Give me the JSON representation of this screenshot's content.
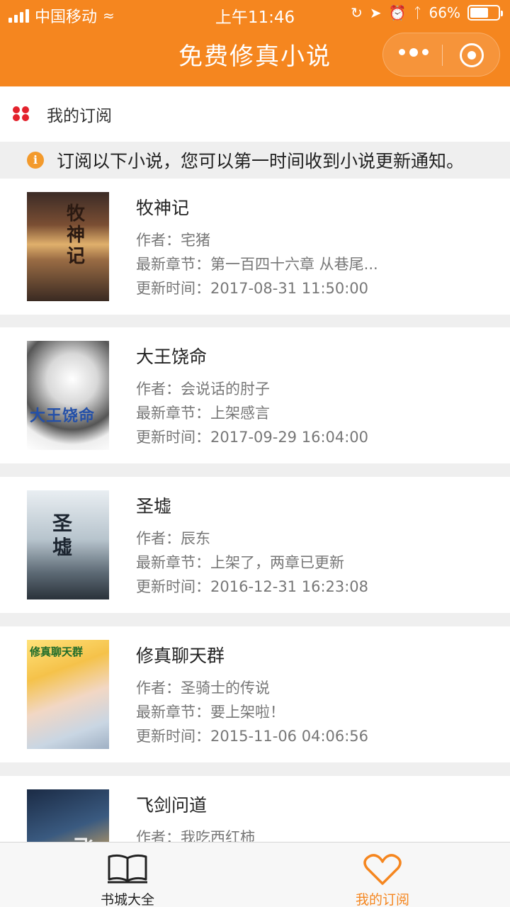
{
  "status_bar": {
    "carrier": "中国移动",
    "time": "上午11:46",
    "battery_text": "66%",
    "battery_level": 0.66
  },
  "nav": {
    "title": "免费修真小说"
  },
  "section": {
    "title": "我的订阅"
  },
  "notice": {
    "text": "订阅以下小说，您可以第一时间收到小说更新通知。"
  },
  "books": [
    {
      "title": "牧神记",
      "author": "作者：宅猪",
      "latest": "最新章节：第一百四十六章 从巷尾...",
      "updated": "更新时间：2017-08-31 11:50:00",
      "cover_text": "牧神记"
    },
    {
      "title": "大王饶命",
      "author": "作者：会说话的肘子",
      "latest": "最新章节：上架感言",
      "updated": "更新时间：2017-09-29 16:04:00",
      "cover_text": "大王饶命"
    },
    {
      "title": "圣墟",
      "author": "作者：辰东",
      "latest": "最新章节：上架了，两章已更新",
      "updated": "更新时间：2016-12-31 16:23:08",
      "cover_text": "圣墟"
    },
    {
      "title": "修真聊天群",
      "author": "作者：圣骑士的传说",
      "latest": "最新章节：要上架啦！",
      "updated": "更新时间：2015-11-06 04:06:56",
      "cover_text": "修真聊天群"
    },
    {
      "title": "飞剑问道",
      "author": "作者：我吃西红柿",
      "latest": "",
      "updated": "",
      "cover_text": "飞剑"
    }
  ],
  "tabbar": {
    "tabs": [
      {
        "label": "书城大全",
        "icon": "book-icon",
        "active": false
      },
      {
        "label": "我的订阅",
        "icon": "heart-icon",
        "active": true
      }
    ]
  },
  "colors": {
    "brand": "#f5861f",
    "accent_red": "#e3222c",
    "info": "#f39a2c"
  }
}
